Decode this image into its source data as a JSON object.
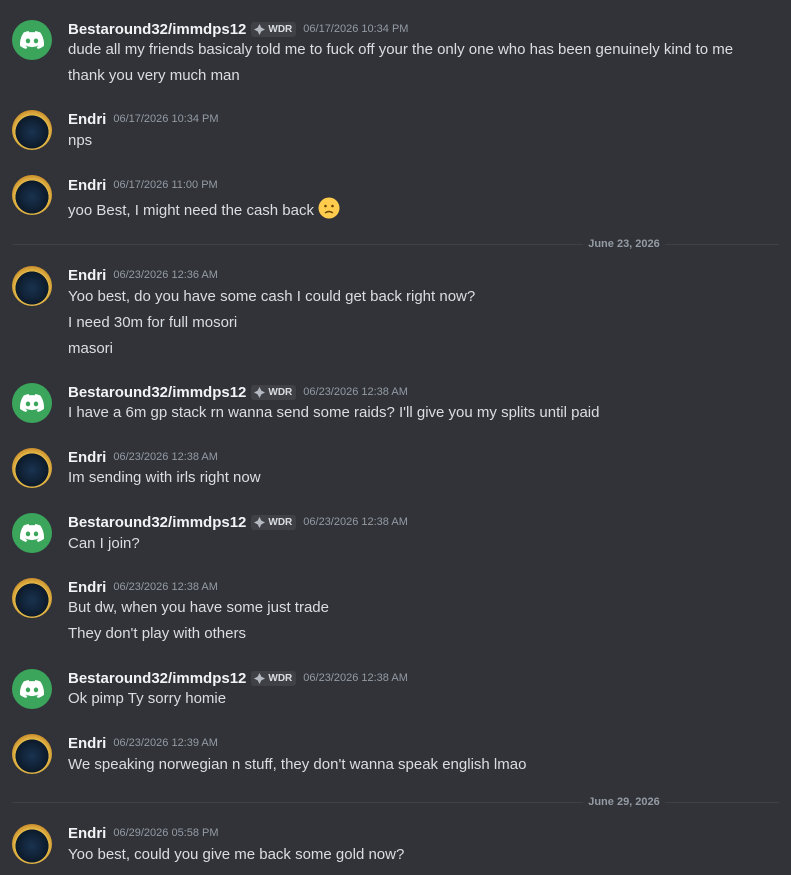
{
  "users": {
    "best": {
      "name": "Bestaround32/immdps12",
      "tag": "WDR",
      "avatar_icon": "discord-logo-icon",
      "avatar_color": "#3ba55c"
    },
    "endri": {
      "name": "Endri",
      "avatar_icon": "character-avatar-icon"
    }
  },
  "messages": [
    {
      "author": "Bestaround32/immdps12",
      "tag": "WDR",
      "time": "06/17/2026 10:34 PM",
      "lines": [
        "dude all my friends basicaly told me to fuck off your the only one who has been genuinely kind to me",
        "thank you very much man"
      ]
    },
    {
      "author": "Endri",
      "time": "06/17/2026 10:34 PM",
      "lines": [
        "nps"
      ]
    },
    {
      "author": "Endri",
      "time": "06/17/2026 11:00 PM",
      "lines": [
        "yoo Best, I might need the cash back"
      ],
      "emoji": "slightly-frowning-face-emoji"
    },
    {
      "author": "Endri",
      "time": "06/23/2026 12:36 AM",
      "lines": [
        "Yoo best, do you have some cash I could get back right now?",
        "I need 30m for full mosori",
        "masori"
      ]
    },
    {
      "author": "Bestaround32/immdps12",
      "tag": "WDR",
      "time": "06/23/2026 12:38 AM",
      "lines": [
        "I have a 6m gp stack rn wanna send some raids? I'll give you my splits until paid"
      ]
    },
    {
      "author": "Endri",
      "time": "06/23/2026 12:38 AM",
      "lines": [
        "Im sending with irls right now"
      ]
    },
    {
      "author": "Bestaround32/immdps12",
      "tag": "WDR",
      "time": "06/23/2026 12:38 AM",
      "lines": [
        "Can I join?"
      ]
    },
    {
      "author": "Endri",
      "time": "06/23/2026 12:38 AM",
      "lines": [
        "But dw, when you have some just trade",
        "They don't play with others"
      ]
    },
    {
      "author": "Bestaround32/immdps12",
      "tag": "WDR",
      "time": "06/23/2026 12:38 AM",
      "lines": [
        "Ok pimp Ty sorry homie"
      ]
    },
    {
      "author": "Endri",
      "time": "06/23/2026 12:39 AM",
      "lines": [
        "We speaking norwegian n stuff, they don't wanna speak english lmao"
      ]
    },
    {
      "author": "Endri",
      "time": "06/29/2026 05:58 PM",
      "lines": [
        "Yoo best, could you give me back some gold now?"
      ]
    }
  ],
  "dividers": [
    "June 23, 2026",
    "June 29, 2026"
  ],
  "colors": {
    "background": "#313338",
    "text": "#dbdee1",
    "author": "#f2f3f5",
    "timestamp": "#949ba4",
    "divider": "#3f4147",
    "tag_bg": "#3f4147"
  }
}
